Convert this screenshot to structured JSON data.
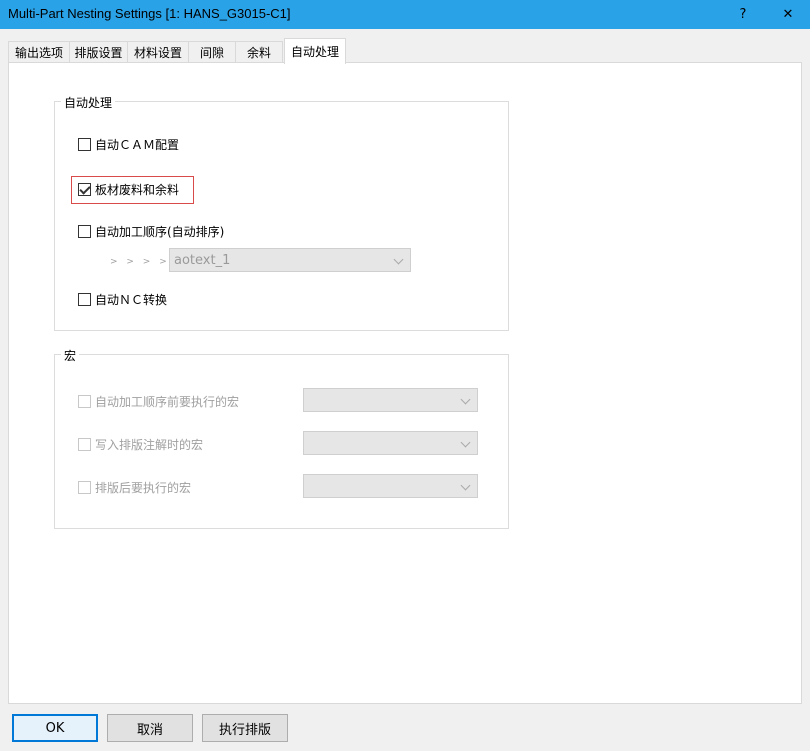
{
  "window": {
    "title": "Multi-Part Nesting Settings [1: HANS_G3015-C1]",
    "help_label": "?",
    "close_label": "✕"
  },
  "tabs": [
    {
      "label": "输出选项"
    },
    {
      "label": "排版设置"
    },
    {
      "label": "材料设置"
    },
    {
      "label": "间隙"
    },
    {
      "label": "余料"
    },
    {
      "label": "自动处理",
      "active": true
    }
  ],
  "auto_group": {
    "title": "自动处理",
    "auto_cam": {
      "label": "自动ＣＡＭ配置",
      "checked": false
    },
    "sheet_scrap": {
      "label": "板材废料和余料",
      "checked": true
    },
    "auto_sequence": {
      "label": "自动加工顺序(自动排序)",
      "checked": false
    },
    "arrows": "> > > >",
    "sequence_select": {
      "value": "aotext_1"
    },
    "auto_nc": {
      "label": "自动ＮＣ转换",
      "checked": false
    }
  },
  "macro_group": {
    "title": "宏",
    "items": [
      {
        "label": "自动加工顺序前要执行的宏",
        "checked": false
      },
      {
        "label": "写入排版注解时的宏",
        "checked": false
      },
      {
        "label": "排版后要执行的宏",
        "checked": false
      }
    ]
  },
  "footer": {
    "ok": "OK",
    "cancel": "取消",
    "execute": "执行排版"
  }
}
